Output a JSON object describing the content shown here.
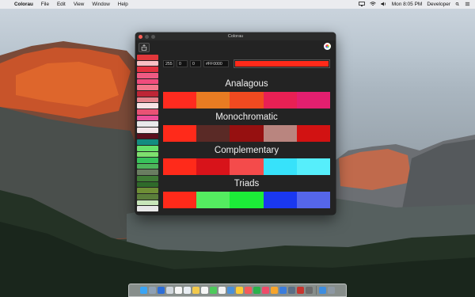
{
  "menubar": {
    "app_name": "Colorau",
    "menus": [
      "File",
      "Edit",
      "View",
      "Window",
      "Help"
    ],
    "clock": "Mon 8:05 PM",
    "user": "Developer"
  },
  "window": {
    "title": "Colorau",
    "inputs": {
      "r": "255",
      "g": "0",
      "b": "0",
      "hex": "#FF0000"
    },
    "current_color": "#ff2a1a",
    "swatches": [
      "#e0373b",
      "#f9c0c4",
      "#e33240",
      "#ef5a83",
      "#f04c7d",
      "#f2778c",
      "#be2536",
      "#e5848d",
      "#f7e3e5",
      "#ea5275",
      "#ec4f9b",
      "#e9e9ea",
      "#f3e6e8",
      "#5a0f1d",
      "#138c80",
      "#67e06a",
      "#7ee06e",
      "#37c25a",
      "#4eb45b",
      "#6a7d61",
      "#3f7a35",
      "#2f6a2a",
      "#6e8e35",
      "#5b7e3b",
      "#c7e5b9",
      "#e8e8e8"
    ],
    "sections": [
      {
        "title": "Analagous",
        "colors": [
          "#ff2b1f",
          "#e87c22",
          "#f14a20",
          "#e82054",
          "#e21f6f"
        ]
      },
      {
        "title": "Monochromatic",
        "colors": [
          "#ff2a1a",
          "#5a2a26",
          "#961010",
          "#b9857f",
          "#d21212"
        ]
      },
      {
        "title": "Complementary",
        "colors": [
          "#ff2a1a",
          "#d8131a",
          "#f44b4b",
          "#37e2fa",
          "#56eefb"
        ]
      },
      {
        "title": "Triads",
        "colors": [
          "#ff2a1a",
          "#54ed60",
          "#1ced38",
          "#1a38f0",
          "#5566ea"
        ]
      }
    ]
  },
  "dock": {
    "icons": [
      "#3aa5f5",
      "#8ea0b4",
      "#2d6ed8",
      "#d0d6dc",
      "#f7f7f7",
      "#e9eef3",
      "#f2c94c",
      "#f6f6f6",
      "#4dca5b",
      "#f4f4f4",
      "#4a90d9",
      "#ffcc33",
      "#f35b5b",
      "#2bb24c",
      "#ef4b6a",
      "#f7a52b",
      "#3b7ddd",
      "#5b6f86",
      "#c8352e",
      "#6c6c6c",
      "#3d8de0",
      "#8d98a3"
    ]
  }
}
